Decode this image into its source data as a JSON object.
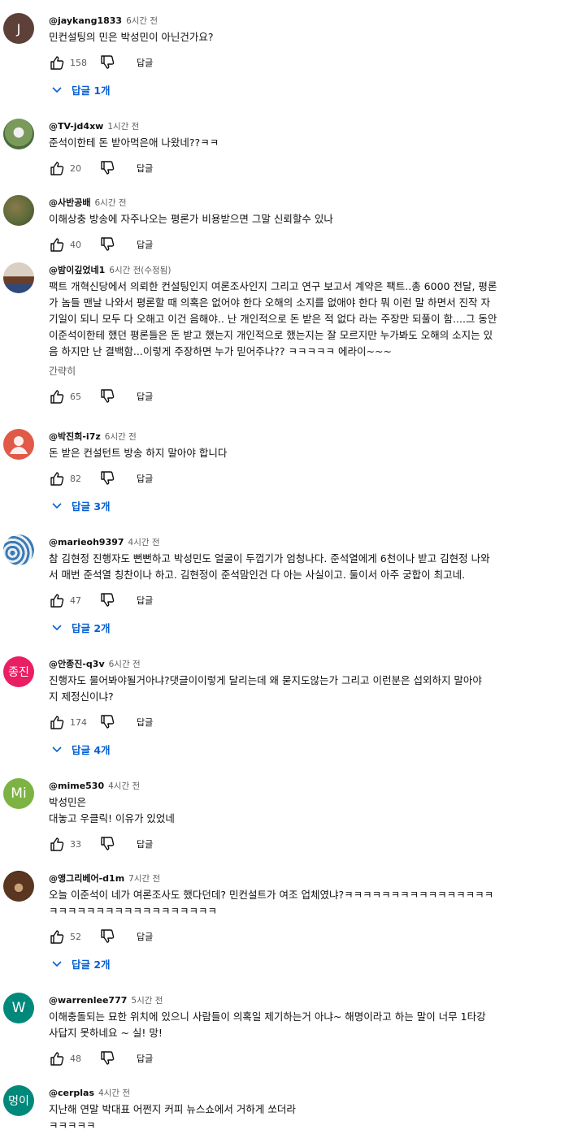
{
  "labels": {
    "reply": "답글",
    "read_less": "간략히"
  },
  "comments": [
    {
      "author": "@jaykang1833",
      "time": "6시간 전",
      "lines": [
        "민컨설팅의 민은 박성민이 아닌건가요?"
      ],
      "likes": "158",
      "replies": "답글 1개",
      "avatar_letter": "J",
      "avatar_color": "#5d4037"
    },
    {
      "author": "@TV-jd4xw",
      "time": "1시간 전",
      "lines": [
        "준석이한테 돈 받아먹은애 나왔네??ㅋㅋ"
      ],
      "likes": "20"
    },
    {
      "author": "@사반공배",
      "time": "6시간 전",
      "lines": [
        "이해상충 방송에 자주나오는 평론가 비용받으면 그말 신뢰할수 있나"
      ],
      "likes": "40"
    },
    {
      "author": "@밤이깊었네1",
      "time": "6시간 전(수정됨)",
      "lines": [
        "팩트 개혁신당에서 의뢰한 컨설팅인지 여론조사인지 그리고 연구 보고서 계약은 팩트..총 6000 전달, 평론",
        "가 놈들 맨날 나와서 평론할 때 의혹은 없어야 한다 오해의 소지를 없애야 한다 뭐 이런 말 하면서 진작 자",
        "기일이 되니 모두 다 오해고 이건 음해야.. 난 개인적으로 돈 받은 적 없다 라는 주장만 되풀이 함....그 동안",
        "이준석이한테 했던 평론들은 돈 받고 했는지 개인적으로 했는지는 잘 모르지만 누가봐도 오해의 소지는 있",
        "음 하지만 난 결백함...이렇게 주장하면 누가 믿어주나?? ㅋㅋㅋㅋㅋ 에라이~~~"
      ],
      "likes": "65",
      "read_less": true
    },
    {
      "author": "@박진희-i7z",
      "time": "6시간 전",
      "lines": [
        "돈 받은 컨설턴트 방송 하지 말아야 합니다"
      ],
      "likes": "82",
      "replies": "답글 3개",
      "avatar_color": "#e05a47"
    },
    {
      "author": "@marieoh9397",
      "time": "4시간 전",
      "lines": [
        "참 김현정 진행자도 뻔뻔하고 박성민도 얼굴이 두껍기가 엄청나다. 준석열에게 6천이나 받고 김현정 나와",
        "서 매번 준석열 칭찬이나 하고. 김현정이 준석맘인건 다 아는 사실이고. 둘이서 아주 궁합이 최고네."
      ],
      "likes": "47",
      "replies": "답글 2개"
    },
    {
      "author": "@안종진-q3v",
      "time": "6시간 전",
      "lines": [
        "진행자도 물어봐야될거아냐?댓글이이렇게 달리는데 왜 묻지도않는가 그리고 이런분은 섭외하지 말아야",
        "지 제정신이냐?"
      ],
      "likes": "174",
      "replies": "답글 4개",
      "avatar_letter": "종진",
      "avatar_color": "#e91e63"
    },
    {
      "author": "@mime530",
      "time": "4시간 전",
      "lines": [
        "박성민은",
        "대놓고 우클릭! 이유가 있었네"
      ],
      "likes": "33",
      "avatar_letter": "Mi",
      "avatar_color": "#7cb342"
    },
    {
      "author": "@앵그리베어-d1m",
      "time": "7시간 전",
      "lines": [
        "오늘 이준석이 네가 여론조사도 했다던데? 민컨설트가 여조 업체였냐?ㅋㅋㅋㅋㅋㅋㅋㅋㅋㅋㅋㅋㅋㅋㅋㅋ",
        "ㅋㅋㅋㅋㅋㅋㅋㅋㅋㅋㅋㅋㅋㅋㅋㅋㅋㅋ"
      ],
      "likes": "52",
      "replies": "답글 2개"
    },
    {
      "author": "@warrenlee777",
      "time": "5시간 전",
      "lines": [
        "이해충돌되는 묘한 위치에 있으니  사람들이 의혹일 제기하는거 아냐~ 해명이라고 하는 말이 너무 1타강",
        "사답지 못하네요 ~ 실! 망!"
      ],
      "likes": "48",
      "avatar_letter": "W",
      "avatar_color": "#00897b"
    },
    {
      "author": "@cerplas",
      "time": "4시간 전",
      "lines": [
        "지난해 연말 박대표 어쩐지 커피 뉴스쇼에서 거하게 쏘더라",
        "ㅋㅋㅋㅋㅋ"
      ],
      "avatar_letter": "멍이",
      "avatar_color": "#00897b"
    }
  ]
}
